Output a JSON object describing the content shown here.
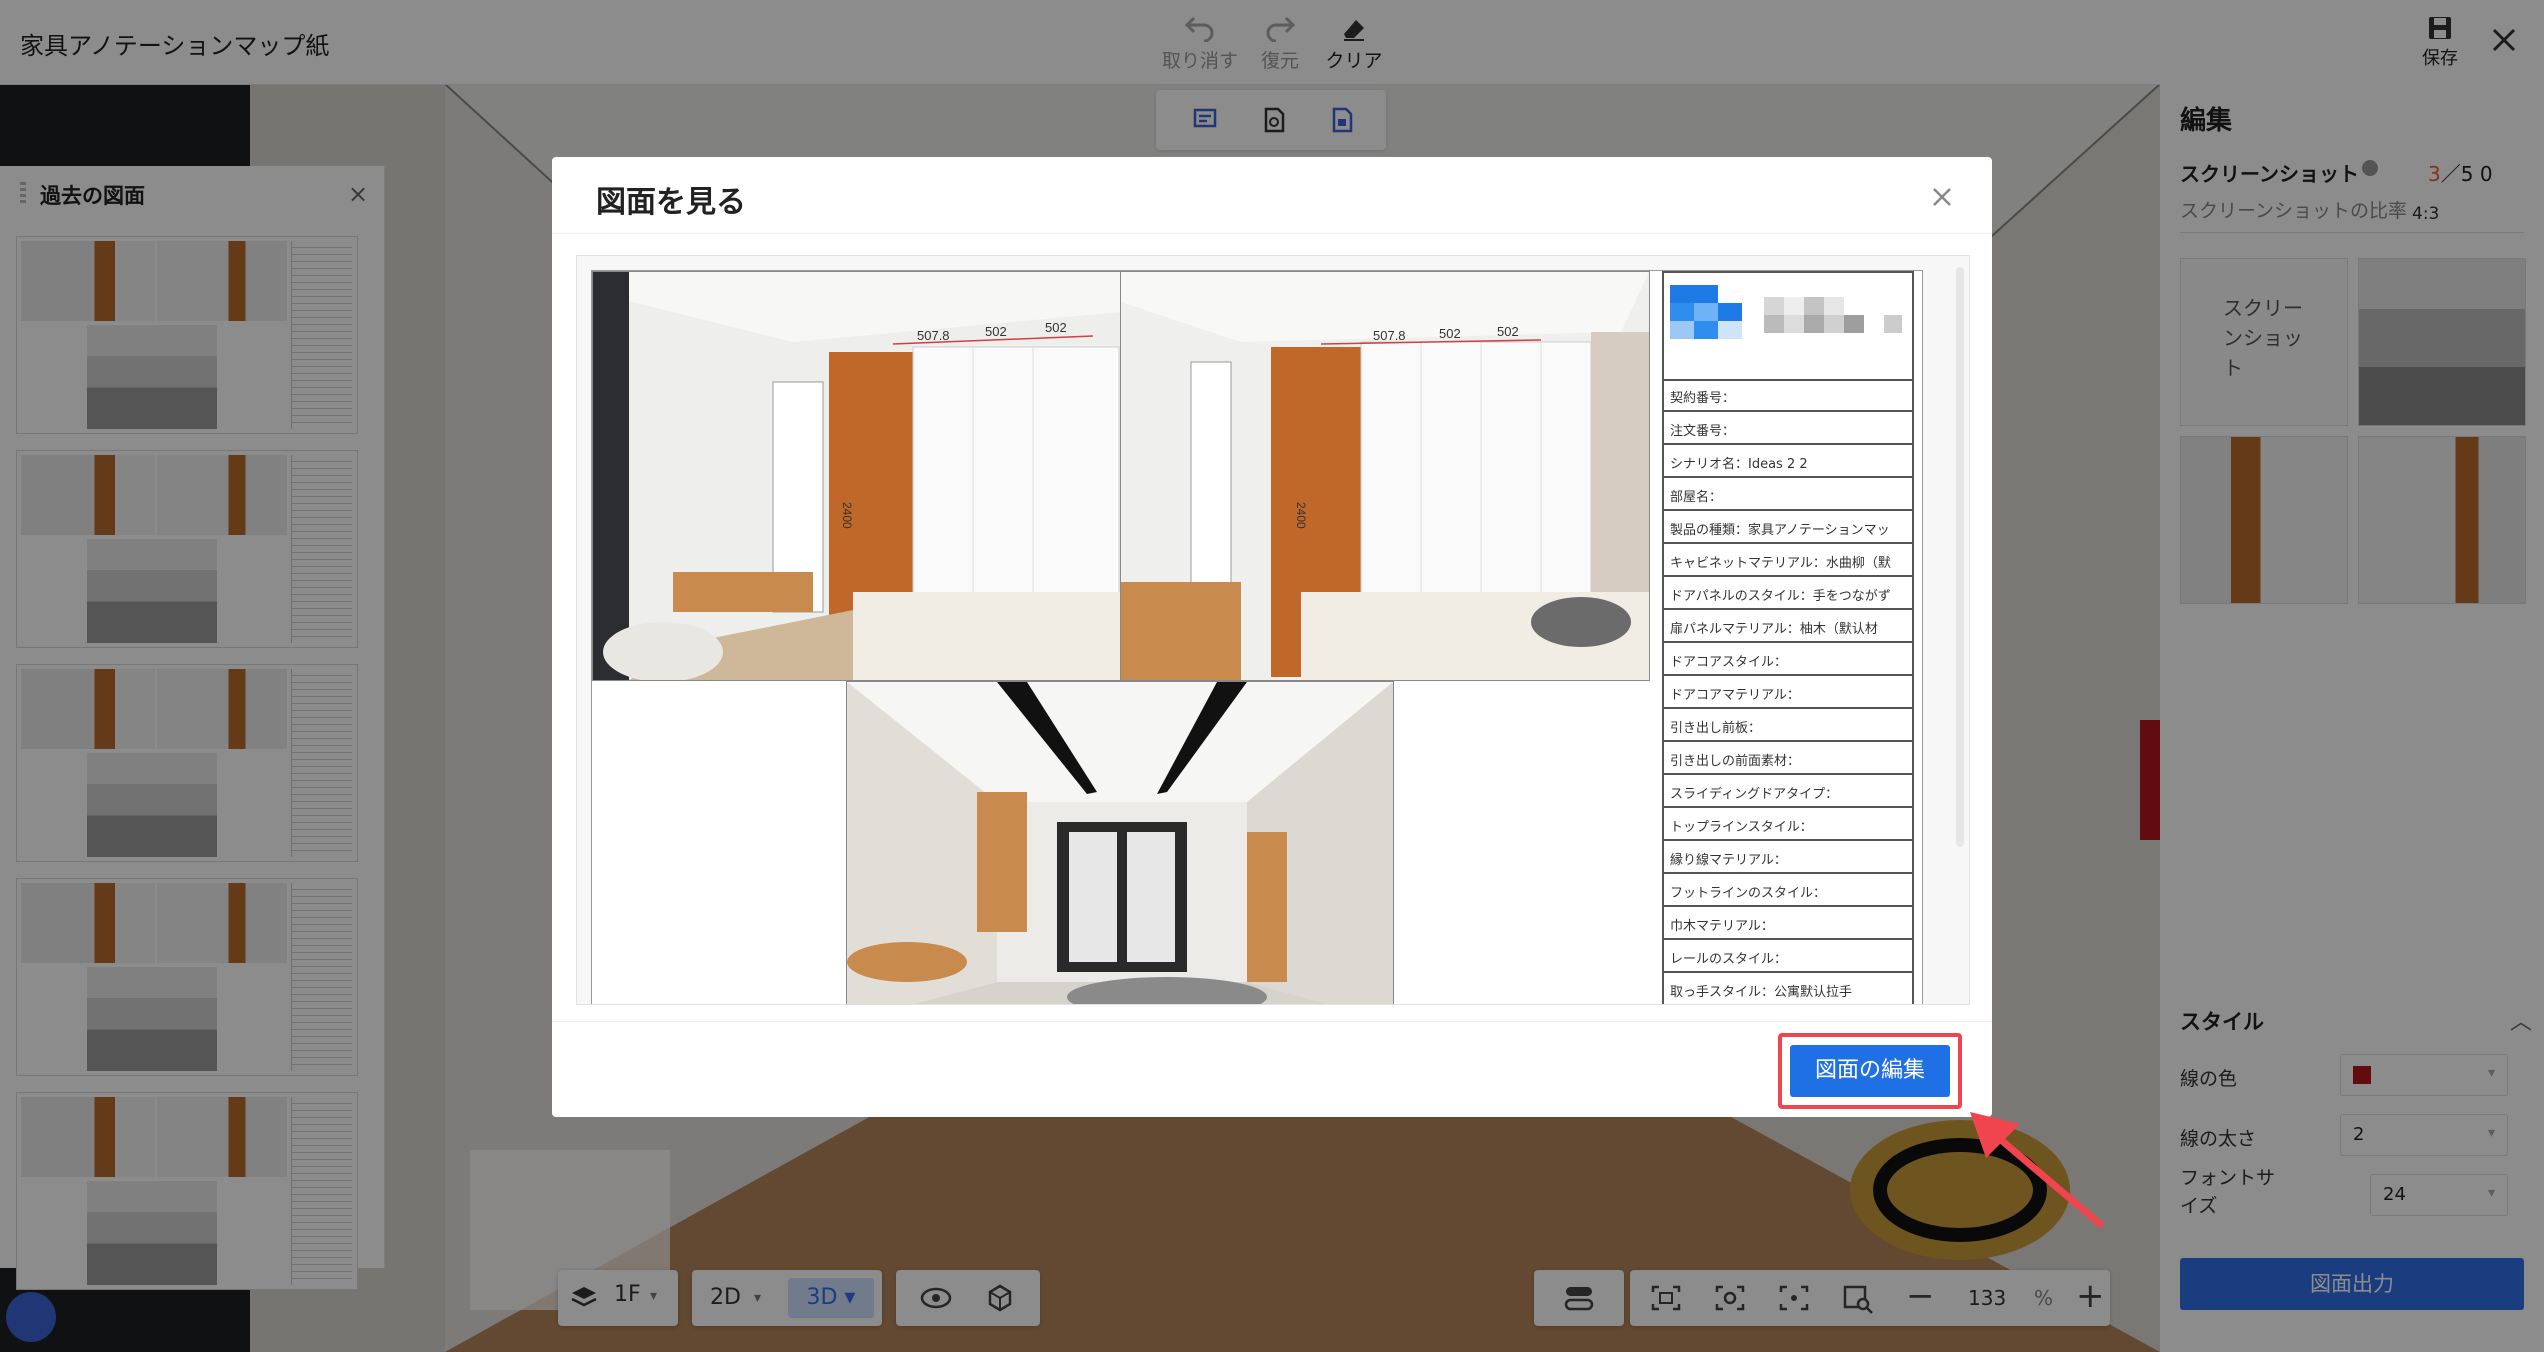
{
  "app": {
    "title": "家具アノテーションマップ紙"
  },
  "toolbar": {
    "undo": "取り消す",
    "redo": "復元",
    "clear": "クリア",
    "save": "保存"
  },
  "history_panel": {
    "title": "過去の図面",
    "thumbnail_count": 5
  },
  "edit_panel": {
    "title": "編集",
    "screenshot_label": "スクリーンショット",
    "screenshot_current": "3",
    "screenshot_sep": "／",
    "screenshot_max": "5 0",
    "ratio_label": "スクリーンショットの比率",
    "ratio_value": "4:3",
    "add_tile_label": "スクリーンショット",
    "style_title": "スタイル",
    "line_color_label": "線の色",
    "line_color_value": "#b3171d",
    "line_width_label": "線の太さ",
    "line_width_value": "2",
    "font_size_label": "フォントサイズ",
    "font_size_value": "24",
    "export_button": "図面出力"
  },
  "bottom_toolbar": {
    "floor": "1F",
    "mode_2d": "2D",
    "mode_3d": "3D",
    "active_mode": "3D",
    "zoom_value": "133",
    "zoom_unit": "%",
    "zoom_minus": "−",
    "zoom_plus": "+"
  },
  "modal": {
    "title": "図面を見る",
    "edit_button": "図面の編集",
    "drawing": {
      "dimensions_top_left": [
        "507.8",
        "502",
        "502"
      ],
      "dimensions_top_right": [
        "507.8",
        "502",
        "502"
      ],
      "dimension_height": "2400",
      "dimension_height_right": "2400",
      "table_rows": [
        "契約番号：",
        "注文番号：",
        "シナリオ名：Ideas 2 2",
        "部屋名：",
        "製品の種類：家具アノテーションマッ",
        "キャビネットマテリアル：水曲柳（默",
        "ドアパネルのスタイル：手をつながず",
        "扉パネルマテリアル：柚木（默认材",
        "ドアコアスタイル：",
        "ドアコアマテリアル：",
        "引き出し前板：",
        "引き出しの前面素材：",
        "スライディングドアタイプ：",
        "トップラインスタイル：",
        "縁り線マテリアル：",
        "フットラインのスタイル：",
        "巾木マテリアル：",
        "レールのスタイル：",
        "取っ手スタイル：公寓默认拉手"
      ]
    }
  }
}
